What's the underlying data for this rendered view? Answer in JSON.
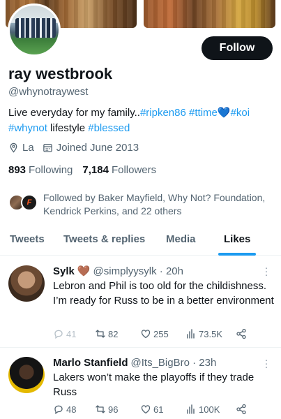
{
  "profile": {
    "name": "ray westbrook",
    "handle": "@whynotraywest",
    "follow_label": "Follow",
    "bio": {
      "line1_text": "Live everyday for my family..",
      "tag1": "#ripken86",
      "tag2": "#ttime",
      "heart": "💙",
      "tag3": "#koi",
      "tag4": "#whynot",
      "text2": "lifestyle",
      "tag5": "#blessed"
    },
    "location": "La",
    "joined": "Joined June 2013",
    "following_count": "893",
    "following_label": "Following",
    "followers_count": "7,184",
    "followers_label": "Followers",
    "followed_by": "Followed by Baker Mayfield, Why Not? Foundation, Kendrick Perkins, and 22 others"
  },
  "tabs": [
    {
      "label": "Tweets"
    },
    {
      "label": "Tweets & replies"
    },
    {
      "label": "Media"
    },
    {
      "label": "Likes"
    }
  ],
  "tweets": [
    {
      "display_name": "Sylk",
      "badge": "🤎",
      "handle": "@simplyysylk",
      "time": "· 20h",
      "text": "Lebron and Phil is too old for the childishness. I’m ready for Russ to be in a better environment",
      "replies": "41",
      "retweets": "82",
      "likes": "255",
      "views": "73.5K"
    },
    {
      "display_name": "Marlo Stanfield",
      "handle": "@Its_BigBro",
      "time": "· 23h",
      "text": "Lakers won’t make the playoffs if they trade Russ",
      "replies": "48",
      "retweets": "96",
      "likes": "61",
      "views": "100K"
    }
  ],
  "colors": {
    "accent": "#1d9bf0",
    "text": "#0f1419",
    "secondary": "#536471"
  }
}
